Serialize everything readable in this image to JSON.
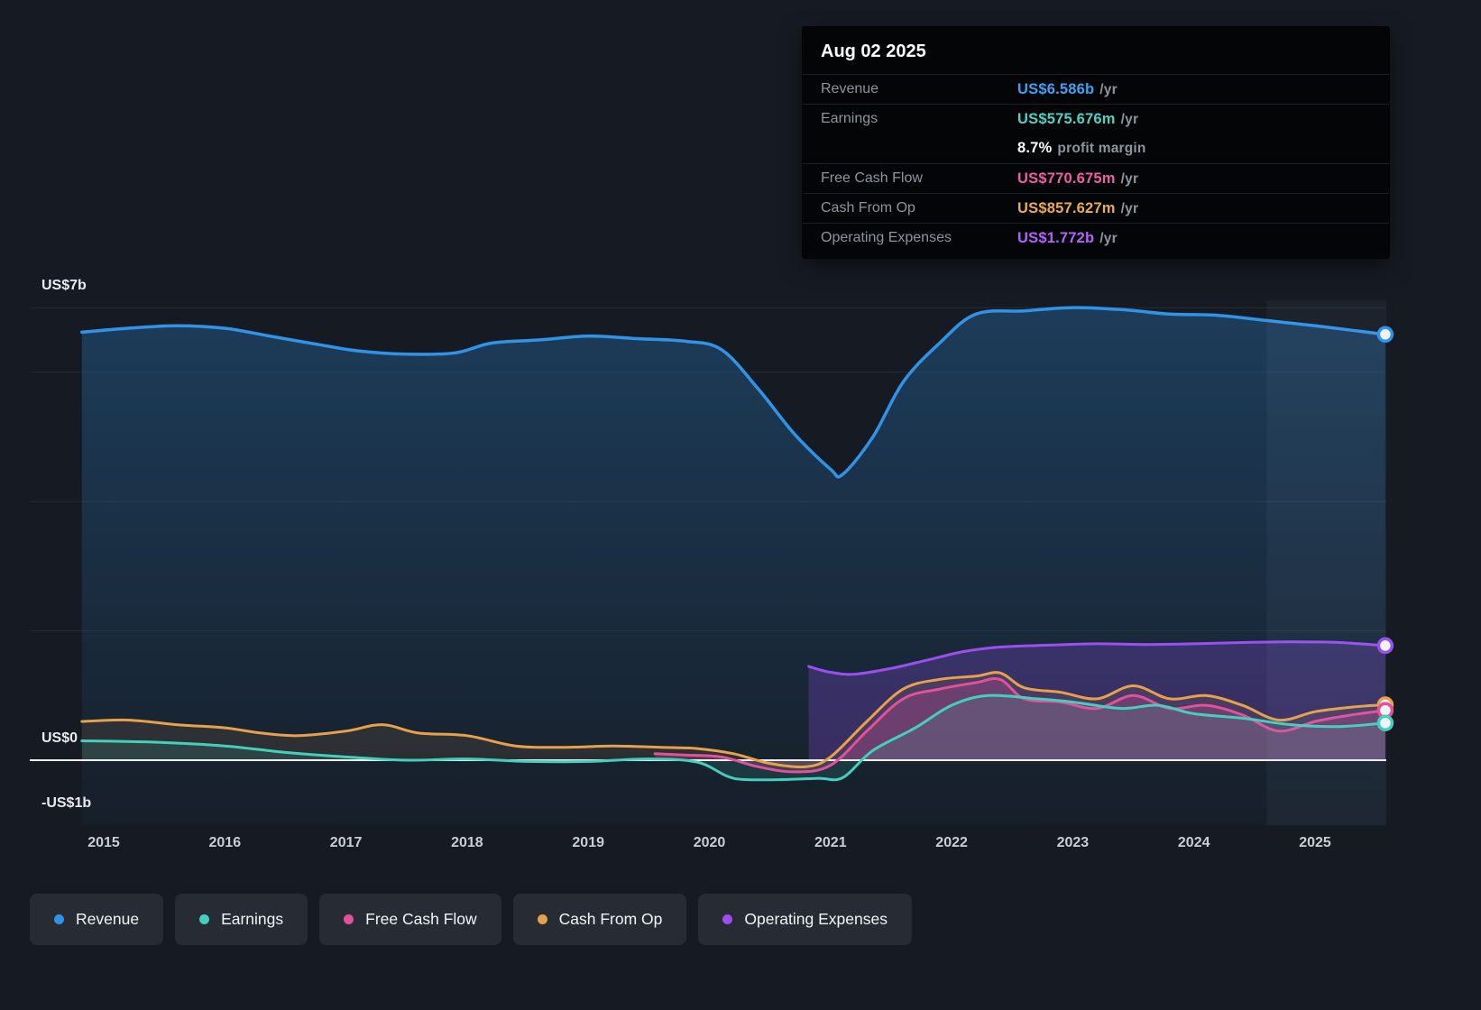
{
  "tooltip": {
    "date": "Aug 02 2025",
    "rows": [
      {
        "label": "Revenue",
        "value": "US$6.586b",
        "suffix": "/yr",
        "color": "#3ba2f5"
      },
      {
        "label": "Earnings",
        "value": "US$575.676m",
        "suffix": "/yr",
        "color": "#50d2c2"
      },
      {
        "label": "",
        "value": "8.7%",
        "suffix": "profit margin",
        "color": "#ffffff"
      },
      {
        "label": "Free Cash Flow",
        "value": "US$770.675m",
        "suffix": "/yr",
        "color": "#ed5fa4"
      },
      {
        "label": "Cash From Op",
        "value": "US$857.627m",
        "suffix": "/yr",
        "color": "#edaa55"
      },
      {
        "label": "Operating Expenses",
        "value": "US$1.772b",
        "suffix": "/yr",
        "color": "#b163fa"
      }
    ]
  },
  "legend": [
    {
      "label": "Revenue",
      "color": "#2f93e8"
    },
    {
      "label": "Earnings",
      "color": "#43cfbc"
    },
    {
      "label": "Free Cash Flow",
      "color": "#e0529c"
    },
    {
      "label": "Cash From Op",
      "color": "#e6a14a"
    },
    {
      "label": "Operating Expenses",
      "color": "#9b4ff0"
    }
  ],
  "chart_data": {
    "type": "area",
    "title": "",
    "units": "USD billions per year",
    "x_range_years": [
      2014.82,
      2025.58
    ],
    "y_range_billions": [
      -1,
      7
    ],
    "grid": true,
    "gridline_values": [
      7,
      6,
      4,
      2
    ],
    "zero_line": true,
    "legend_position": "bottom",
    "highlight_from_x": 2024.6,
    "x_tick_labels": [
      "2015",
      "2016",
      "2017",
      "2018",
      "2019",
      "2020",
      "2021",
      "2022",
      "2023",
      "2024",
      "2025"
    ],
    "y_axis_labels": [
      {
        "text": "US$7b",
        "value": 7
      },
      {
        "text": "US$0",
        "value": 0
      },
      {
        "text": "-US$1b",
        "value": -1
      }
    ],
    "series": [
      {
        "name": "Revenue",
        "color": "#2f93e8",
        "gradient": true,
        "base": "bottom",
        "width": 3.5,
        "x": [
          2014.82,
          2015.2,
          2015.6,
          2016.0,
          2016.4,
          2016.8,
          2017.1,
          2017.5,
          2017.9,
          2018.2,
          2018.6,
          2019.0,
          2019.4,
          2019.8,
          2020.1,
          2020.4,
          2020.7,
          2021.0,
          2021.1,
          2021.35,
          2021.6,
          2021.9,
          2022.2,
          2022.6,
          2023.0,
          2023.4,
          2023.8,
          2024.2,
          2024.6,
          2025.0,
          2025.3,
          2025.58
        ],
        "values": [
          6.62,
          6.68,
          6.72,
          6.68,
          6.55,
          6.42,
          6.33,
          6.28,
          6.3,
          6.45,
          6.5,
          6.56,
          6.52,
          6.48,
          6.35,
          5.75,
          5.05,
          4.5,
          4.42,
          5.0,
          5.85,
          6.45,
          6.9,
          6.95,
          7.0,
          6.97,
          6.9,
          6.88,
          6.8,
          6.72,
          6.65,
          6.586
        ]
      },
      {
        "name": "Operating Expenses",
        "color": "#9b4ff0",
        "fill": "rgba(150,80,242,0.25)",
        "base": "zero",
        "width": 3,
        "x": [
          2020.82,
          2021.0,
          2021.2,
          2021.5,
          2021.8,
          2022.1,
          2022.4,
          2022.8,
          2023.2,
          2023.6,
          2024.0,
          2024.4,
          2024.8,
          2025.2,
          2025.58
        ],
        "values": [
          1.45,
          1.36,
          1.33,
          1.42,
          1.55,
          1.68,
          1.75,
          1.78,
          1.8,
          1.79,
          1.8,
          1.82,
          1.83,
          1.82,
          1.772
        ]
      },
      {
        "name": "Cash From Op",
        "color": "#e6a14a",
        "fill": "rgba(233,160,76,0.10)",
        "base": "zero",
        "width": 3,
        "x": [
          2014.82,
          2015.2,
          2015.6,
          2016.0,
          2016.3,
          2016.6,
          2017.0,
          2017.3,
          2017.6,
          2018.0,
          2018.4,
          2018.8,
          2019.2,
          2019.6,
          2019.9,
          2020.2,
          2020.5,
          2020.8,
          2021.0,
          2021.3,
          2021.6,
          2021.9,
          2022.2,
          2022.4,
          2022.6,
          2022.9,
          2023.2,
          2023.5,
          2023.8,
          2024.1,
          2024.4,
          2024.7,
          2025.0,
          2025.3,
          2025.58
        ],
        "values": [
          0.6,
          0.62,
          0.55,
          0.5,
          0.42,
          0.38,
          0.45,
          0.55,
          0.42,
          0.38,
          0.22,
          0.2,
          0.22,
          0.2,
          0.18,
          0.1,
          -0.05,
          -0.1,
          0.05,
          0.6,
          1.1,
          1.25,
          1.3,
          1.35,
          1.12,
          1.05,
          0.95,
          1.15,
          0.95,
          1.0,
          0.85,
          0.62,
          0.75,
          0.82,
          0.858
        ]
      },
      {
        "name": "Free Cash Flow",
        "color": "#e0529c",
        "fill": "rgba(232,83,159,0.22)",
        "base": "zero",
        "width": 3,
        "x": [
          2019.55,
          2019.8,
          2020.1,
          2020.4,
          2020.7,
          2021.0,
          2021.3,
          2021.6,
          2021.9,
          2022.2,
          2022.4,
          2022.6,
          2022.9,
          2023.2,
          2023.5,
          2023.8,
          2024.1,
          2024.4,
          2024.7,
          2025.0,
          2025.3,
          2025.58
        ],
        "values": [
          0.1,
          0.08,
          0.05,
          -0.1,
          -0.18,
          -0.08,
          0.45,
          0.95,
          1.1,
          1.2,
          1.25,
          0.95,
          0.9,
          0.8,
          1.0,
          0.8,
          0.85,
          0.7,
          0.45,
          0.6,
          0.7,
          0.771
        ]
      },
      {
        "name": "Earnings",
        "color": "#43cfbc",
        "fill": "rgba(64,210,189,0.13)",
        "base": "zero",
        "width": 3,
        "x": [
          2014.82,
          2015.4,
          2016.0,
          2016.5,
          2017.0,
          2017.5,
          2018.0,
          2018.5,
          2019.0,
          2019.5,
          2019.9,
          2020.15,
          2020.3,
          2020.6,
          2020.9,
          2021.1,
          2021.35,
          2021.7,
          2022.0,
          2022.3,
          2022.7,
          2023.0,
          2023.4,
          2023.7,
          2024.0,
          2024.4,
          2024.8,
          2025.2,
          2025.58
        ],
        "values": [
          0.3,
          0.28,
          0.22,
          0.12,
          0.05,
          0.0,
          0.02,
          -0.02,
          -0.02,
          0.02,
          -0.03,
          -0.25,
          -0.3,
          -0.3,
          -0.28,
          -0.27,
          0.15,
          0.5,
          0.85,
          1.0,
          0.95,
          0.9,
          0.8,
          0.85,
          0.72,
          0.65,
          0.55,
          0.52,
          0.576
        ]
      }
    ]
  }
}
